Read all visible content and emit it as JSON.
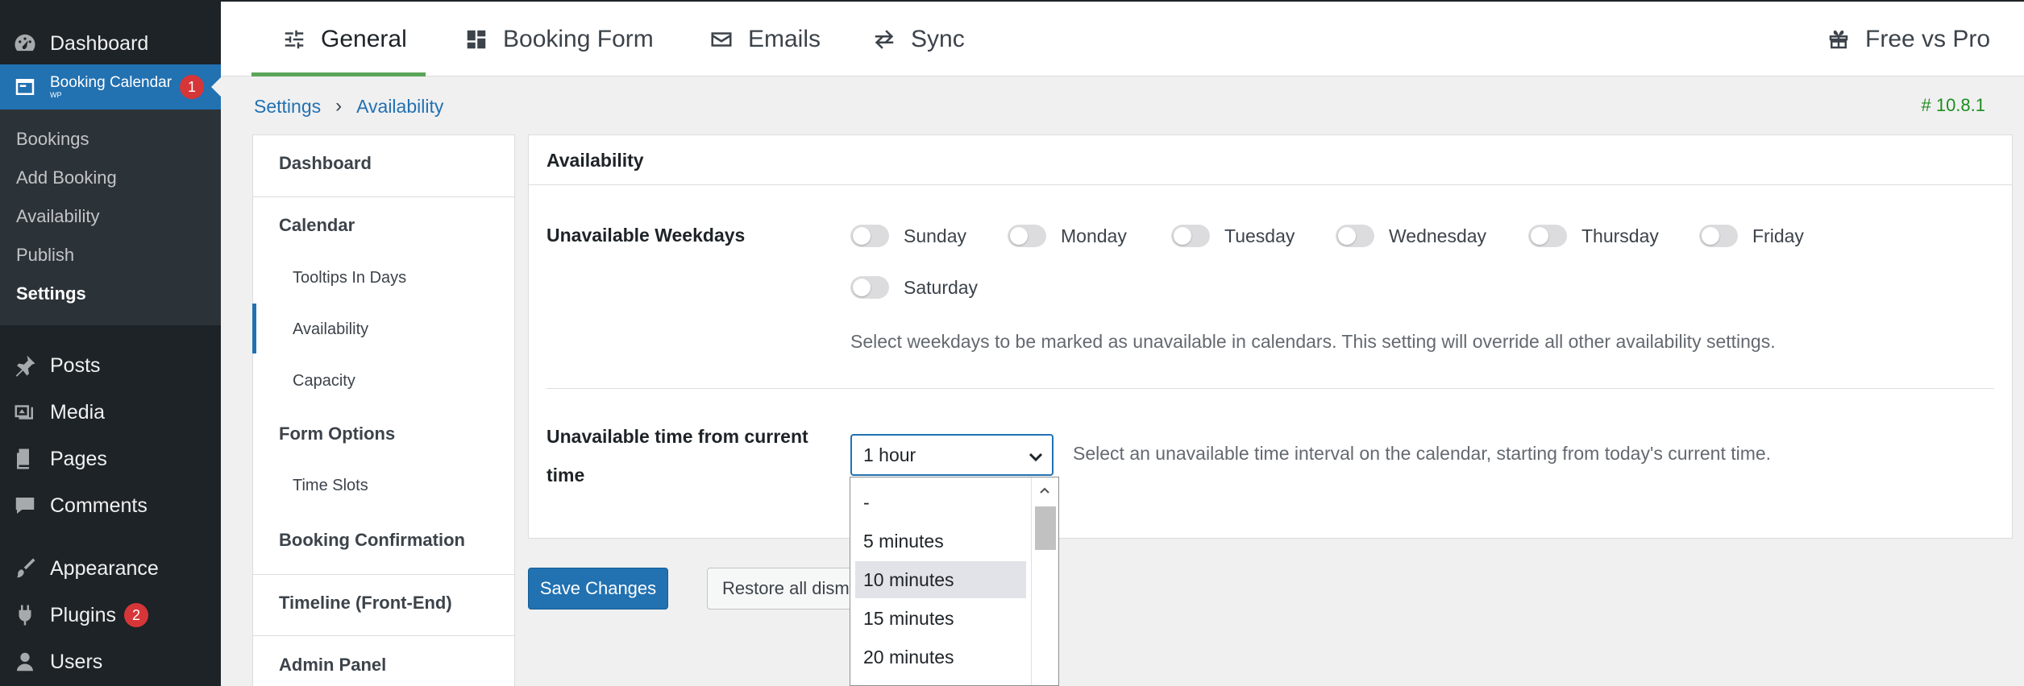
{
  "wp_menu": {
    "dashboard": "Dashboard",
    "booking_calendar": "Booking Calendar",
    "booking_calendar_sub": "WP",
    "booking_badge": "1",
    "submenu": [
      "Bookings",
      "Add Booking",
      "Availability",
      "Publish",
      "Settings"
    ],
    "posts": "Posts",
    "media": "Media",
    "pages": "Pages",
    "comments": "Comments",
    "appearance": "Appearance",
    "plugins": "Plugins",
    "plugins_badge": "2",
    "users": "Users"
  },
  "tabs": {
    "general": "General",
    "booking_form": "Booking Form",
    "emails": "Emails",
    "sync": "Sync",
    "free_vs_pro": "Free vs Pro"
  },
  "breadcrumb": {
    "root": "Settings",
    "current": "Availability"
  },
  "version": "# 10.8.1",
  "settings_nav": {
    "dashboard": "Dashboard",
    "calendar": "Calendar",
    "tooltips": "Tooltips In Days",
    "availability": "Availability",
    "capacity": "Capacity",
    "form_options": "Form Options",
    "time_slots": "Time Slots",
    "booking_confirmation": "Booking Confirmation",
    "timeline": "Timeline (Front-End)",
    "admin_panel": "Admin Panel"
  },
  "panel": {
    "title": "Availability",
    "weekdays_label": "Unavailable Weekdays",
    "weekdays": [
      "Sunday",
      "Monday",
      "Tuesday",
      "Wednesday",
      "Thursday",
      "Friday",
      "Saturday"
    ],
    "weekdays_desc": "Select weekdays to be marked as unavailable in calendars. This setting will override all other availability settings.",
    "time_label_line1": "Unavailable time from current",
    "time_label_line2": "time",
    "time_value": "1 hour",
    "time_desc": "Select an unavailable time interval on the calendar, starting from today's current time."
  },
  "buttons": {
    "save": "Save Changes",
    "restore": "Restore all dismissed windows"
  },
  "dropdown_options": [
    "-",
    "5 minutes",
    "10 minutes",
    "15 minutes",
    "20 minutes"
  ],
  "dropdown_highlighted": "10 minutes",
  "colors": {
    "accent": "#2271b1",
    "sidebar": "#1d2327",
    "tab_active": "#5ba55a",
    "version": "#1e8c1e"
  }
}
